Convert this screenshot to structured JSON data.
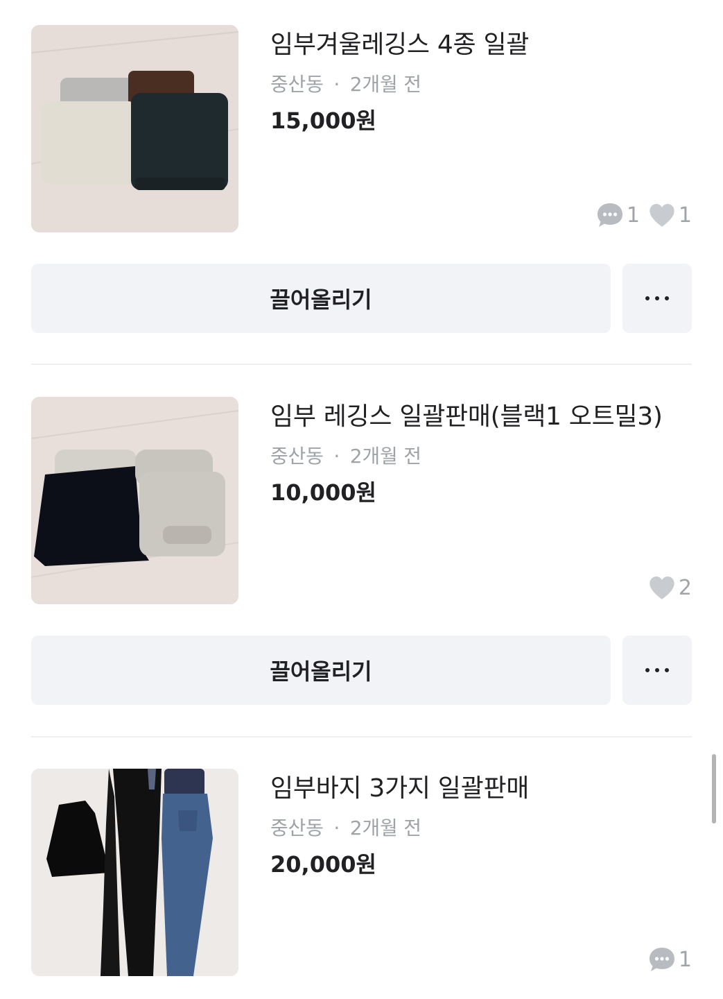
{
  "listings": [
    {
      "title": "임부겨울레깅스 4종 일괄",
      "location": "중산동",
      "time": "2개월 전",
      "separator": "·",
      "price": "15,000원",
      "chat_count": "1",
      "like_count": "1",
      "bump_label": "끌어올리기"
    },
    {
      "title": "임부 레깅스 일괄판매(블랙1 오트밀3)",
      "location": "중산동",
      "time": "2개월 전",
      "separator": "·",
      "price": "10,000원",
      "like_count": "2",
      "bump_label": "끌어올리기"
    },
    {
      "title": "임부바지 3가지 일괄판매",
      "location": "중산동",
      "time": "2개월 전",
      "separator": "·",
      "price": "20,000원",
      "chat_count": "1"
    }
  ],
  "icons": {
    "chat": "chat-bubble-icon",
    "like": "heart-icon",
    "more": "more-horizontal-icon"
  },
  "colors": {
    "text": "#212124",
    "muted": "#9ea3a8",
    "button_bg": "#f2f3f6",
    "divider": "#eeeff1"
  }
}
